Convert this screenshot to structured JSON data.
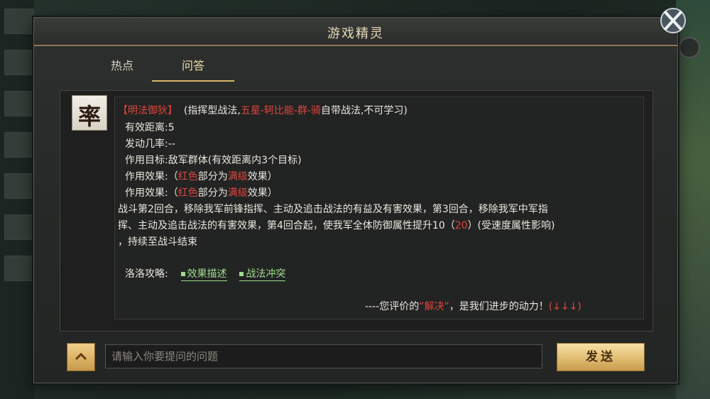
{
  "dialog": {
    "title": "游戏精灵",
    "tabs": [
      {
        "label": "热点",
        "active": false
      },
      {
        "label": "问答",
        "active": true
      }
    ]
  },
  "answer": {
    "avatar_char": "率",
    "tactic_name": "【明法御狄】",
    "tactic_desc_prefix": "(指挥型战法,",
    "tactic_source": "五星-轲比能-群-骑",
    "tactic_desc_suffix": "自带战法,不可学习)",
    "range_line": "有效距离:5",
    "chance_line": "发动几率:--",
    "target_line": "作用目标:敌军群体(有效距离内3个目标)",
    "effect_lines": [
      {
        "prefix": "作用效果:（",
        "red1": "红色",
        "mid": "部分为",
        "red2": "满级",
        "suffix": "效果）"
      },
      {
        "prefix": "作用效果:（",
        "red1": "红色",
        "mid": "部分为",
        "red2": "满级",
        "suffix": "效果）"
      }
    ],
    "desc_line1": "战斗第2回合，移除我军前锋指挥、主动及追击战法的有益及有害效果，第3回合，移除我军中军指",
    "desc_line2_prefix": "挥、主动及追击战法的有害效果，第4回合起，使我军全体防御属性提升10（",
    "desc_line2_red": "20",
    "desc_line2_suffix": "）(受速度属性影响)",
    "desc_line3": "，持续至战斗结束",
    "guide_label": "洛洛攻略:",
    "guide_links": [
      "效果描述",
      "战法冲突"
    ],
    "feedback_prefix": "----您评价的",
    "feedback_red": "“解决”",
    "feedback_mid": "，是我们进步的动力！",
    "feedback_arrows": "(↓↓↓)"
  },
  "footer": {
    "input_placeholder": "请输入你要提问的问题",
    "send_label": "发送"
  },
  "colors": {
    "accent_gold": "#d8b66a",
    "highlight_red": "#e0443c",
    "link_green": "#9fdb8c"
  },
  "icons": [
    "close-icon",
    "chevron-up-icon",
    "map-pin-icon"
  ]
}
